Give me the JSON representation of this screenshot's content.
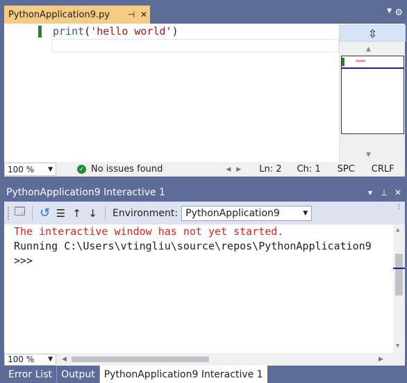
{
  "editor": {
    "tab": {
      "filename": "PythonApplication9.py",
      "pin_icon": "pin-icon",
      "close_icon": "close-icon"
    },
    "tab_strip": {
      "dropdown_icon": "chevron-down-icon",
      "settings_icon": "gear-icon"
    },
    "code": {
      "line1": {
        "fn": "print",
        "open": "(",
        "string": "'hello world'",
        "close": ")"
      }
    },
    "map": {
      "split_icon": "split-icon",
      "up_icon": "arrow-up-icon",
      "down_icon": "arrow-down-icon"
    },
    "status": {
      "zoom": "100 %",
      "issues": "No issues found",
      "line": "Ln: 2",
      "column": "Ch: 1",
      "whitespace": "SPC",
      "line_ending": "CRLF"
    }
  },
  "interactive": {
    "title": "PythonApplication9 Interactive 1",
    "title_icons": [
      "chevron-down-icon",
      "pin-icon",
      "close-icon"
    ],
    "toolbar": {
      "environment_label": "Environment:",
      "environment_value": "PythonApplication9"
    },
    "output": {
      "error_line": "The interactive window has not yet started.",
      "running_line": "Running C:\\Users\\vtingliu\\source\\repos\\PythonApplication9",
      "prompt": ">>>"
    },
    "status": {
      "zoom": "100 %"
    }
  },
  "bottom_tabs": [
    {
      "label": "Error List",
      "active": false
    },
    {
      "label": "Output",
      "active": false
    },
    {
      "label": "PythonApplication9 Interactive 1",
      "active": true
    }
  ],
  "colors": {
    "chrome": "#5d6b99",
    "active_tab": "#f5cc84",
    "error_text": "#e51c1c",
    "keyword": "#2f54a8",
    "string": "#a31515",
    "success": "#1e8a3b"
  }
}
